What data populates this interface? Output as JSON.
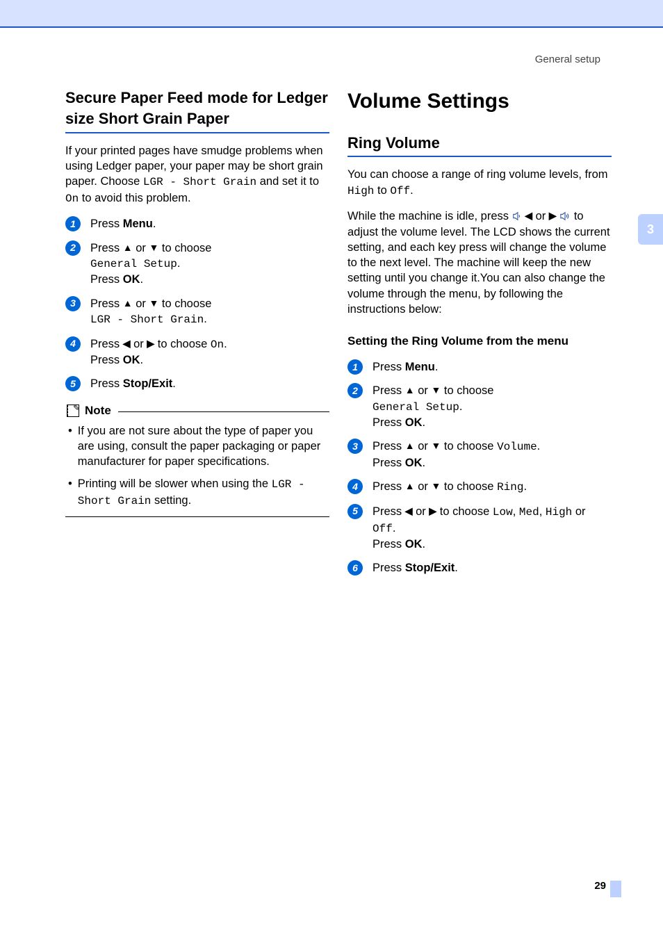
{
  "header": {
    "category": "General setup"
  },
  "left": {
    "h2": "Secure Paper Feed mode for Ledger size Short Grain Paper",
    "intro_pre": "If your printed pages have smudge problems when using Ledger paper, your paper may be short grain paper. Choose ",
    "intro_code": "LGR - Short Grain",
    "intro_mid": " and set it to ",
    "intro_code2": "On",
    "intro_post": " to avoid this problem.",
    "steps": {
      "s1_a": "Press ",
      "s1_b": "Menu",
      "s1_c": ".",
      "s2_a": "Press ",
      "s2_b": " or ",
      "s2_c": " to choose ",
      "s2_code": "General Setup",
      "s2_d": ".",
      "s2_e": "Press ",
      "s2_f": "OK",
      "s2_g": ".",
      "s3_a": "Press ",
      "s3_b": " or ",
      "s3_c": " to choose ",
      "s3_code": "LGR - Short Grain",
      "s3_d": ".",
      "s4_a": "Press ",
      "s4_b": " or ",
      "s4_c": " to choose ",
      "s4_code": "On",
      "s4_d": ".",
      "s4_e": "Press ",
      "s4_f": "OK",
      "s4_g": ".",
      "s5_a": "Press ",
      "s5_b": "Stop/Exit",
      "s5_c": "."
    },
    "note_label": "Note",
    "note1": "If you are not sure about the type of paper you are using, consult the paper packaging or paper manufacturer for paper specifications.",
    "note2_a": "Printing will be slower when using the ",
    "note2_code": "LGR - Short Grain",
    "note2_b": " setting."
  },
  "right": {
    "h1": "Volume Settings",
    "h2": "Ring Volume",
    "p1_a": "You can choose a range of ring volume levels, from ",
    "p1_code1": "High",
    "p1_b": " to ",
    "p1_code2": "Off",
    "p1_c": ".",
    "p2_a": "While the machine is idle, press ",
    "p2_b": " or ",
    "p2_c": " to adjust the volume level. The LCD shows the current setting, and each key press will change the volume to the next level. The machine will keep the new setting until you change it.You can also change the volume through the menu, by following the instructions below:",
    "sub": "Setting the Ring Volume from the menu",
    "steps": {
      "s1_a": "Press ",
      "s1_b": "Menu",
      "s1_c": ".",
      "s2_a": "Press ",
      "s2_b": " or ",
      "s2_c": " to choose ",
      "s2_code": "General Setup",
      "s2_d": ".",
      "s2_e": "Press ",
      "s2_f": "OK",
      "s2_g": ".",
      "s3_a": "Press ",
      "s3_b": " or ",
      "s3_c": " to choose ",
      "s3_code": "Volume",
      "s3_d": ".",
      "s3_e": "Press ",
      "s3_f": "OK",
      "s3_g": ".",
      "s4_a": "Press ",
      "s4_b": " or ",
      "s4_c": " to choose ",
      "s4_code": "Ring",
      "s4_d": ".",
      "s5_a": "Press ",
      "s5_b": " or ",
      "s5_c": " to choose ",
      "s5_code1": "Low",
      "s5_m1": ", ",
      "s5_code2": "Med",
      "s5_m2": ", ",
      "s5_code3": "High",
      "s5_m3": " or ",
      "s5_code4": "Off",
      "s5_d": ".",
      "s5_e": "Press ",
      "s5_f": "OK",
      "s5_g": ".",
      "s6_a": "Press ",
      "s6_b": "Stop/Exit",
      "s6_c": "."
    }
  },
  "sidetab": "3",
  "pagenum": "29",
  "sym": {
    "up": "▲",
    "down": "▼",
    "left": "◀",
    "right": "▶",
    "tri_left": "◀",
    "tri_right": "▶"
  }
}
